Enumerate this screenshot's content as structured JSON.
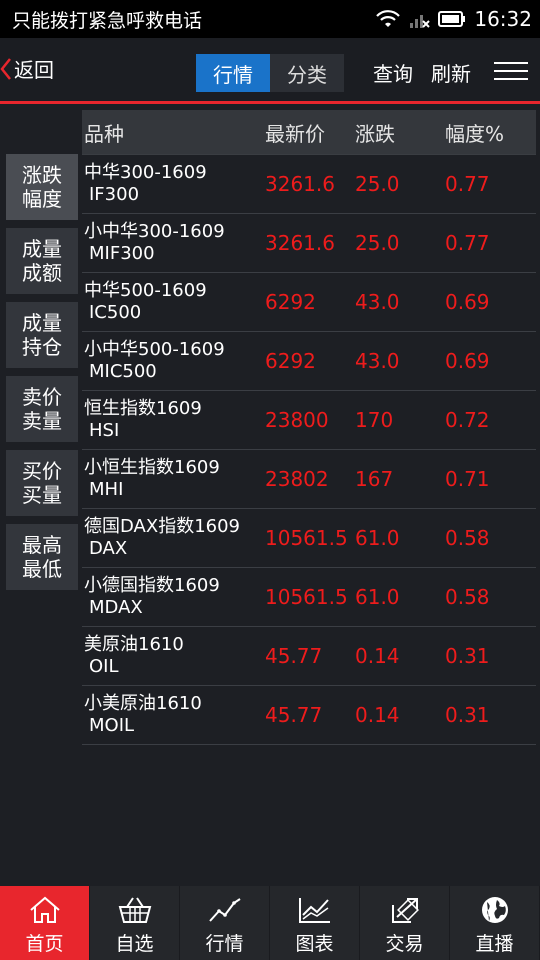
{
  "status_bar": {
    "carrier": "只能拨打紧急呼救电话",
    "time": "16:32"
  },
  "nav": {
    "back_label": "返回",
    "tabs": [
      {
        "label": "行情",
        "active": true
      },
      {
        "label": "分类",
        "active": false
      }
    ],
    "query_label": "查询",
    "refresh_label": "刷新",
    "accent_color": "#e8262d",
    "tab_active_color": "#1a73c9"
  },
  "sidebar": {
    "buttons": [
      {
        "line1": "涨跌",
        "line2": "幅度",
        "active": true
      },
      {
        "line1": "成量",
        "line2": "成额",
        "active": false
      },
      {
        "line1": "成量",
        "line2": "持仓",
        "active": false
      },
      {
        "line1": "卖价",
        "line2": "卖量",
        "active": false
      },
      {
        "line1": "买价",
        "line2": "买量",
        "active": false
      },
      {
        "line1": "最高",
        "line2": "最低",
        "active": false
      }
    ]
  },
  "table": {
    "headers": {
      "name": "品种",
      "price": "最新价",
      "change": "涨跌",
      "pct": "幅度%"
    },
    "up_color": "#ee1c1c",
    "rows": [
      {
        "name": "中华300-1609",
        "code": "IF300",
        "price": "3261.6",
        "change": "25.0",
        "pct": "0.77"
      },
      {
        "name": "小中华300-1609",
        "code": "MIF300",
        "price": "3261.6",
        "change": "25.0",
        "pct": "0.77"
      },
      {
        "name": "中华500-1609",
        "code": "IC500",
        "price": "6292",
        "change": "43.0",
        "pct": "0.69"
      },
      {
        "name": "小中华500-1609",
        "code": "MIC500",
        "price": "6292",
        "change": "43.0",
        "pct": "0.69"
      },
      {
        "name": "恒生指数1609",
        "code": "HSI",
        "price": "23800",
        "change": "170",
        "pct": "0.72"
      },
      {
        "name": "小恒生指数1609",
        "code": "MHI",
        "price": "23802",
        "change": "167",
        "pct": "0.71"
      },
      {
        "name": "德国DAX指数1609",
        "code": "DAX",
        "price": "10561.5",
        "change": "61.0",
        "pct": "0.58"
      },
      {
        "name": "小德国指数1609",
        "code": "MDAX",
        "price": "10561.5",
        "change": "61.0",
        "pct": "0.58"
      },
      {
        "name": "美原油1610",
        "code": "OIL",
        "price": "45.77",
        "change": "0.14",
        "pct": "0.31"
      },
      {
        "name": "小美原油1610",
        "code": "MOIL",
        "price": "45.77",
        "change": "0.14",
        "pct": "0.31"
      }
    ]
  },
  "tabbar": {
    "items": [
      {
        "label": "首页",
        "icon": "home-icon",
        "active": true
      },
      {
        "label": "自选",
        "icon": "basket-icon",
        "active": false
      },
      {
        "label": "行情",
        "icon": "trend-line-icon",
        "active": false
      },
      {
        "label": "图表",
        "icon": "chart-icon",
        "active": false
      },
      {
        "label": "交易",
        "icon": "trade-icon",
        "active": false
      },
      {
        "label": "直播",
        "icon": "globe-icon",
        "active": false
      }
    ]
  }
}
